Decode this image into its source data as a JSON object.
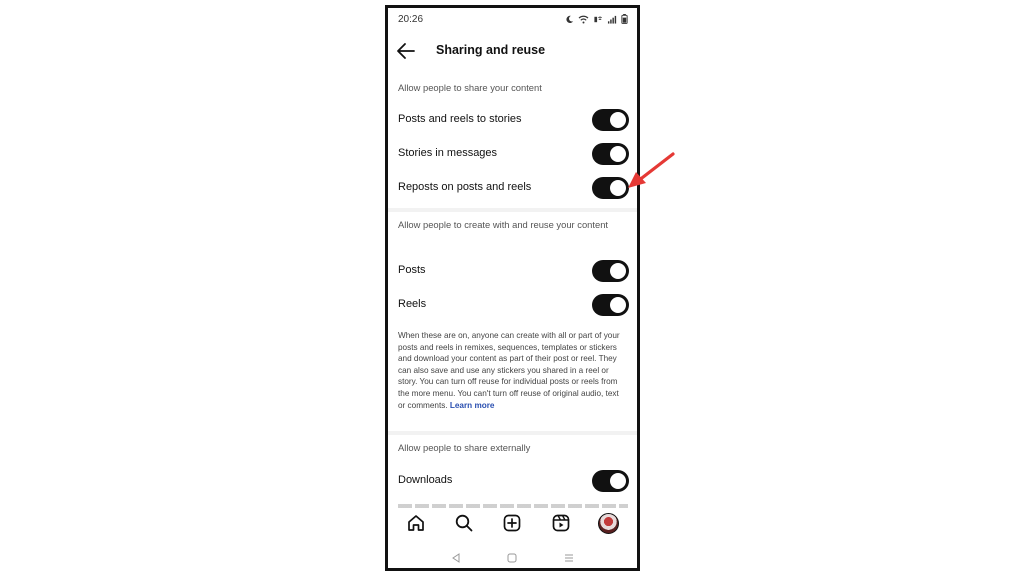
{
  "status_bar": {
    "time": "20:26",
    "icons": [
      "moon-icon",
      "wifi-icon",
      "wifi-call-icon",
      "signal-icon",
      "battery-icon"
    ]
  },
  "header": {
    "title": "Sharing and reuse",
    "back_icon": "back-arrow-icon"
  },
  "sections": [
    {
      "header": "Allow people to share your content",
      "items": [
        {
          "label": "Posts and reels to stories",
          "on": true
        },
        {
          "label": "Stories in messages",
          "on": true
        },
        {
          "label": "Reposts on posts and reels",
          "on": true
        }
      ]
    },
    {
      "header": "Allow people to create with and reuse your content",
      "items": [
        {
          "label": "Posts",
          "on": true
        },
        {
          "label": "Reels",
          "on": true
        }
      ],
      "info": "When these are on, anyone can create with all or part of your posts and reels in remixes, sequences, templates or stickers and download your content as part of their post or reel. They can also save and use any stickers you shared in a reel or story. You can turn off reuse for individual posts or reels from the more menu. You can't turn off reuse of original audio, text or comments.",
      "info_link": "Learn more"
    },
    {
      "header": "Allow people to share externally",
      "items": [
        {
          "label": "Downloads",
          "on": true
        }
      ]
    }
  ],
  "bottom_nav": [
    "home-icon",
    "search-icon",
    "create-icon",
    "reels-icon",
    "profile-avatar"
  ],
  "system_nav": [
    "back-triangle-icon",
    "home-square-icon",
    "recents-menu-icon"
  ],
  "colors": {
    "toggle_on": "#111111",
    "link": "#2a4fb0",
    "annotation_arrow": "#e53935"
  }
}
